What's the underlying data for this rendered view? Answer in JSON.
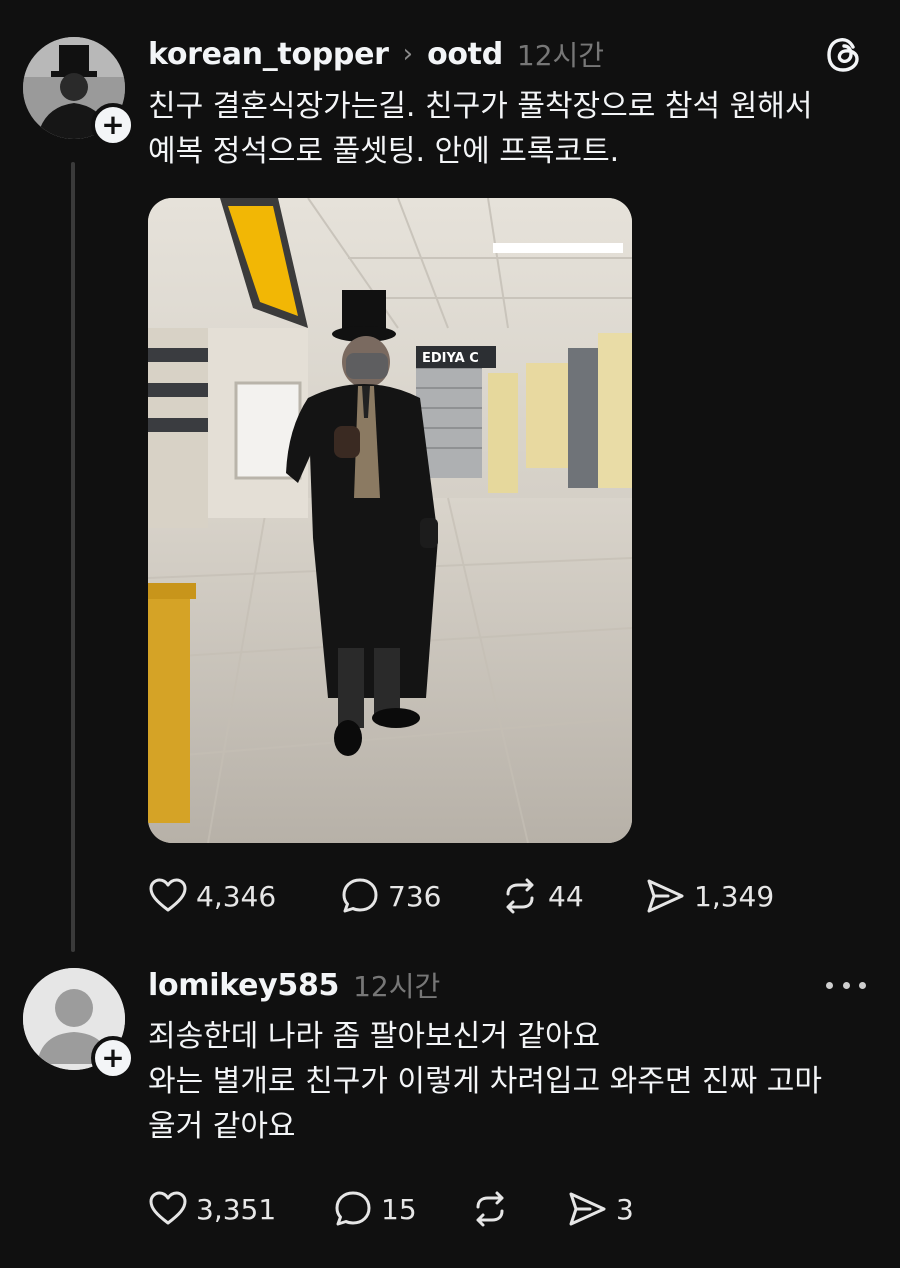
{
  "post": {
    "username": "korean_topper",
    "separator": "›",
    "tag": "ootd",
    "time": "12시간",
    "lines": [
      "친구 결혼식장가는길. 친구가 풀착장으로 참석 원해서",
      "예복 정석으로 풀셋팅. 안에 프록코트."
    ],
    "image_sign_text": "EDIYA C",
    "stats": {
      "likes": "4,346",
      "comments": "736",
      "reposts": "44",
      "shares": "1,349"
    }
  },
  "comment": {
    "username": "lomikey585",
    "time": "12시간",
    "lines": [
      "죄송한데 나라 좀 팔아보신거 같아요",
      "와는 별개로 친구가 이렇게 차려입고 와주면 진짜 고마",
      "울거 같아요"
    ],
    "stats": {
      "likes": "3,351",
      "comments": "15",
      "reposts": "",
      "shares": "3"
    }
  },
  "icons": [
    "threads-logo-icon",
    "plus-icon",
    "heart-icon",
    "comment-icon",
    "repost-icon",
    "share-icon",
    "more-icon"
  ]
}
